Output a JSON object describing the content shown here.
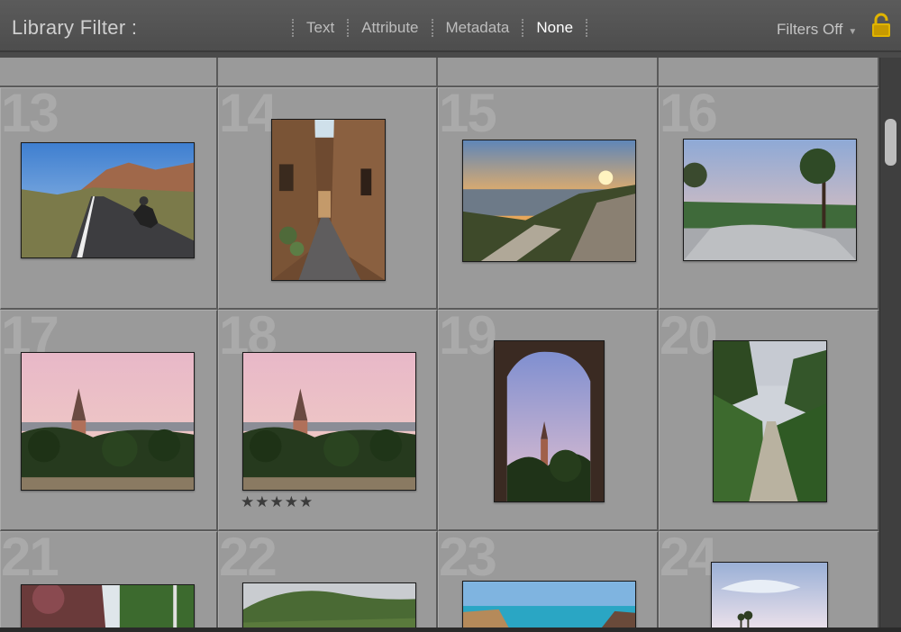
{
  "filter_bar": {
    "title": "Library Filter :",
    "tabs": [
      {
        "label": "Text",
        "active": false
      },
      {
        "label": "Attribute",
        "active": false
      },
      {
        "label": "Metadata",
        "active": false
      },
      {
        "label": "None",
        "active": true
      }
    ],
    "preset_label": "Filters Off",
    "lock_icon": "lock-icon",
    "lock_color": "#e0b400"
  },
  "grid": {
    "cells": [
      {
        "number": "13",
        "photo": "motorcycle-road",
        "orientation": "landscape",
        "rating": ""
      },
      {
        "number": "14",
        "photo": "narrow-alley",
        "orientation": "portrait",
        "rating": ""
      },
      {
        "number": "15",
        "photo": "city-sunset-overlook",
        "orientation": "landscape",
        "rating": ""
      },
      {
        "number": "16",
        "photo": "park-plaza-pine",
        "orientation": "landscape",
        "rating": ""
      },
      {
        "number": "17",
        "photo": "church-spire-palms",
        "orientation": "landscape",
        "rating": ""
      },
      {
        "number": "18",
        "photo": "church-spire-palms",
        "orientation": "landscape",
        "rating": "★★★★★"
      },
      {
        "number": "19",
        "photo": "spire-through-arch",
        "orientation": "portrait",
        "rating": ""
      },
      {
        "number": "20",
        "photo": "stone-path-trees",
        "orientation": "portrait",
        "rating": ""
      },
      {
        "number": "21",
        "photo": "trees-sky",
        "orientation": "landscape",
        "rating": ""
      },
      {
        "number": "22",
        "photo": "green-hill",
        "orientation": "landscape",
        "rating": ""
      },
      {
        "number": "23",
        "photo": "sea-coast",
        "orientation": "landscape",
        "rating": ""
      },
      {
        "number": "24",
        "photo": "sky-palms",
        "orientation": "landscape",
        "rating": ""
      }
    ]
  },
  "colors": {
    "cell_bg": "#9a9a9a",
    "cell_number": "#aaaaaa",
    "active_tab": "#ffffff",
    "inactive_tab": "#bdbdbd"
  }
}
